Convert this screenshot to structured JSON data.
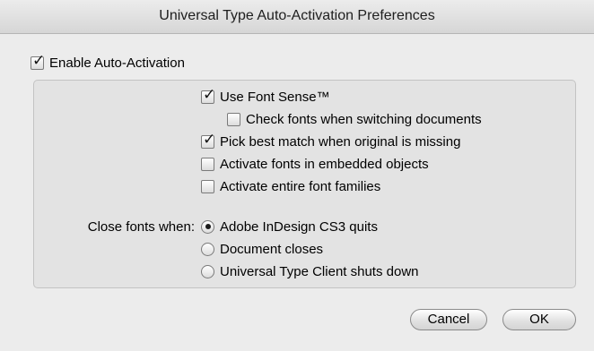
{
  "window": {
    "title": "Universal Type Auto-Activation Preferences"
  },
  "enable": {
    "label": "Enable Auto-Activation",
    "checked": true
  },
  "options": {
    "font_sense": {
      "label": "Use Font Sense™",
      "checked": true
    },
    "check_fonts": {
      "label": "Check fonts when switching documents",
      "checked": false
    },
    "pick_best": {
      "label": "Pick best match when original is missing",
      "checked": true
    },
    "embedded": {
      "label": "Activate fonts in embedded objects",
      "checked": false
    },
    "families": {
      "label": "Activate entire font families",
      "checked": false
    }
  },
  "close_fonts": {
    "label": "Close fonts when:",
    "options": [
      {
        "label": "Adobe InDesign CS3 quits",
        "selected": true
      },
      {
        "label": "Document closes",
        "selected": false
      },
      {
        "label": "Universal Type Client shuts down",
        "selected": false
      }
    ]
  },
  "buttons": {
    "cancel": "Cancel",
    "ok": "OK"
  }
}
